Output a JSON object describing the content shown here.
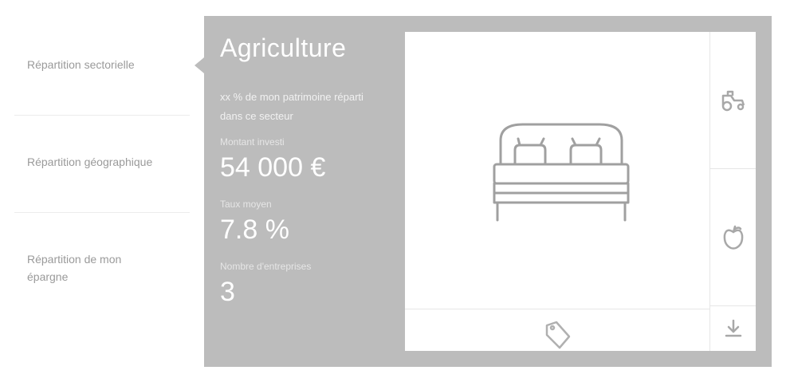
{
  "menu": {
    "items": [
      {
        "label": "Répartition sectorielle"
      },
      {
        "label": "Répartition géographique"
      },
      {
        "label": "Répartition de mon épargne"
      }
    ]
  },
  "sector": {
    "title": "Agriculture",
    "description": "xx % de mon patrimoine réparti dans ce secteur",
    "stats": [
      {
        "label": "Montant investi",
        "value": "54 000 €"
      },
      {
        "label": "Taux moyen",
        "value": "7.8 %"
      },
      {
        "label": "Nombre d'entreprises",
        "value": "3"
      }
    ]
  },
  "icons": {
    "hero": "bed-icon",
    "bottom": "tag-icon",
    "side": [
      "tractor-icon",
      "apple-icon",
      "download-icon"
    ]
  },
  "colors": {
    "card_bg": "#bcbcbc",
    "panel_bg": "#ffffff",
    "text_on_card": "#ffffff",
    "menu_text": "#9a9a9a",
    "icon_stroke": "#a0a0a0"
  }
}
